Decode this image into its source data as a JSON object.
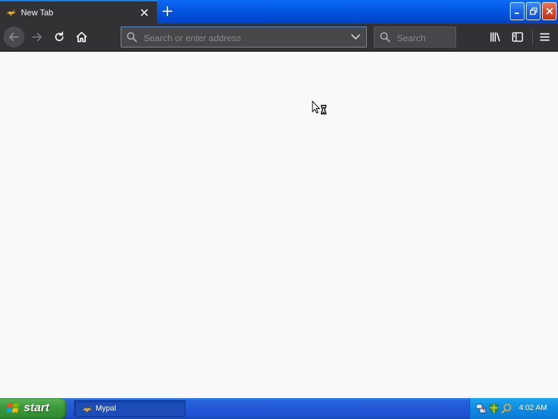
{
  "browser": {
    "tab": {
      "title": "New Tab",
      "favicon": "mypal-bird-icon"
    },
    "urlbar": {
      "placeholder": "Search or enter address",
      "value": ""
    },
    "searchbar": {
      "placeholder": "Search",
      "value": ""
    },
    "icons": {
      "back": "arrow-left-icon",
      "forward": "arrow-right-icon",
      "reload": "reload-icon",
      "home": "home-icon",
      "library": "library-icon",
      "sidebar": "sidebar-icon",
      "menu": "hamburger-menu-icon"
    },
    "content": {
      "cursor": "busy-hourglass-cursor"
    }
  },
  "taskbar": {
    "start_label": "start",
    "tasks": [
      {
        "label": "Mypal",
        "icon": "mypal-bird-icon"
      }
    ],
    "tray_icons": [
      "network-icon",
      "security-shield-icon",
      "search-icon"
    ],
    "clock": "4:02 AM"
  },
  "colors": {
    "toolbar": "#323234",
    "title_bar": "#0355e0",
    "content_bg": "#f9f9fa",
    "taskbar": "#245edb",
    "start_button": "#3a9a3a",
    "tray": "#0f8ae0"
  }
}
